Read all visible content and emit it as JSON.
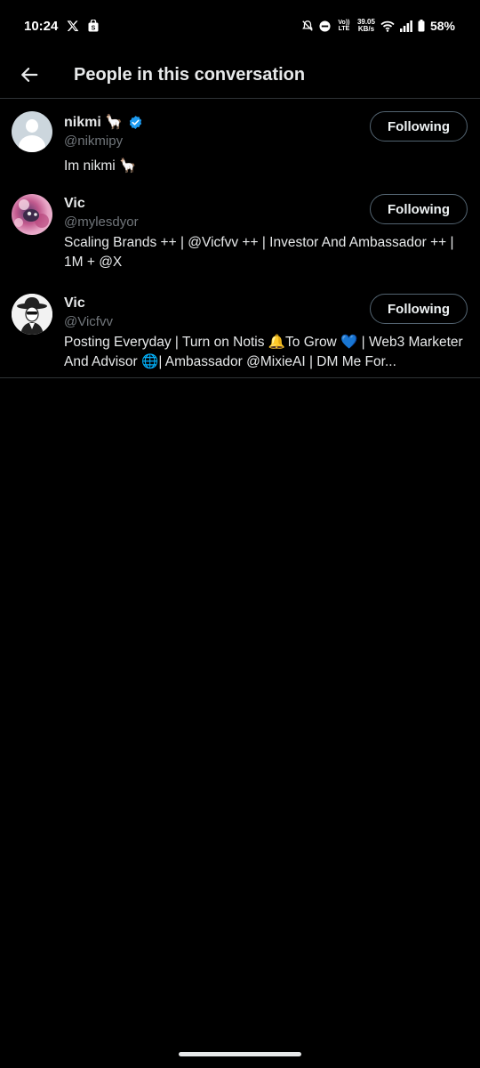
{
  "status_bar": {
    "time": "10:24",
    "net_speed_value": "39.05",
    "net_speed_unit": "KB/s",
    "volte": "Vo)) LTE",
    "battery": "58%",
    "icons": [
      "x-logo-icon",
      "shopping-bag-icon",
      "mute-bell-icon",
      "do-not-disturb-icon",
      "wifi-icon",
      "signal-icon",
      "battery-icon"
    ]
  },
  "header": {
    "title": "People in this conversation",
    "back_icon": "arrow-left-icon"
  },
  "people": [
    {
      "name": "nikmi 🦙",
      "handle": "@nikmipy",
      "verified": true,
      "bio": "Im nikmi 🦙",
      "button": "Following",
      "avatar": "default-avatar"
    },
    {
      "name": "Vic",
      "handle": "@mylesdyor",
      "verified": false,
      "bio": "Scaling Brands ++ | @Vicfvv ++ | Investor And Ambassador ++ | 1M + @X",
      "button": "Following",
      "avatar": "pink-abstract-avatar"
    },
    {
      "name": "Vic",
      "handle": "@Vicfvv",
      "verified": false,
      "bio": "Posting Everyday | Turn on Notis 🔔To Grow 💙 | Web3 Marketer And Advisor 🌐| Ambassador @MixieAI  | DM Me For...",
      "button": "Following",
      "avatar": "sketch-cowboy-avatar"
    }
  ],
  "colors": {
    "background": "#000000",
    "text_primary": "#e7e9ea",
    "text_secondary": "#71767b",
    "divider": "#2f3336",
    "verified": "#1d9bf0",
    "button_border": "#536471"
  }
}
